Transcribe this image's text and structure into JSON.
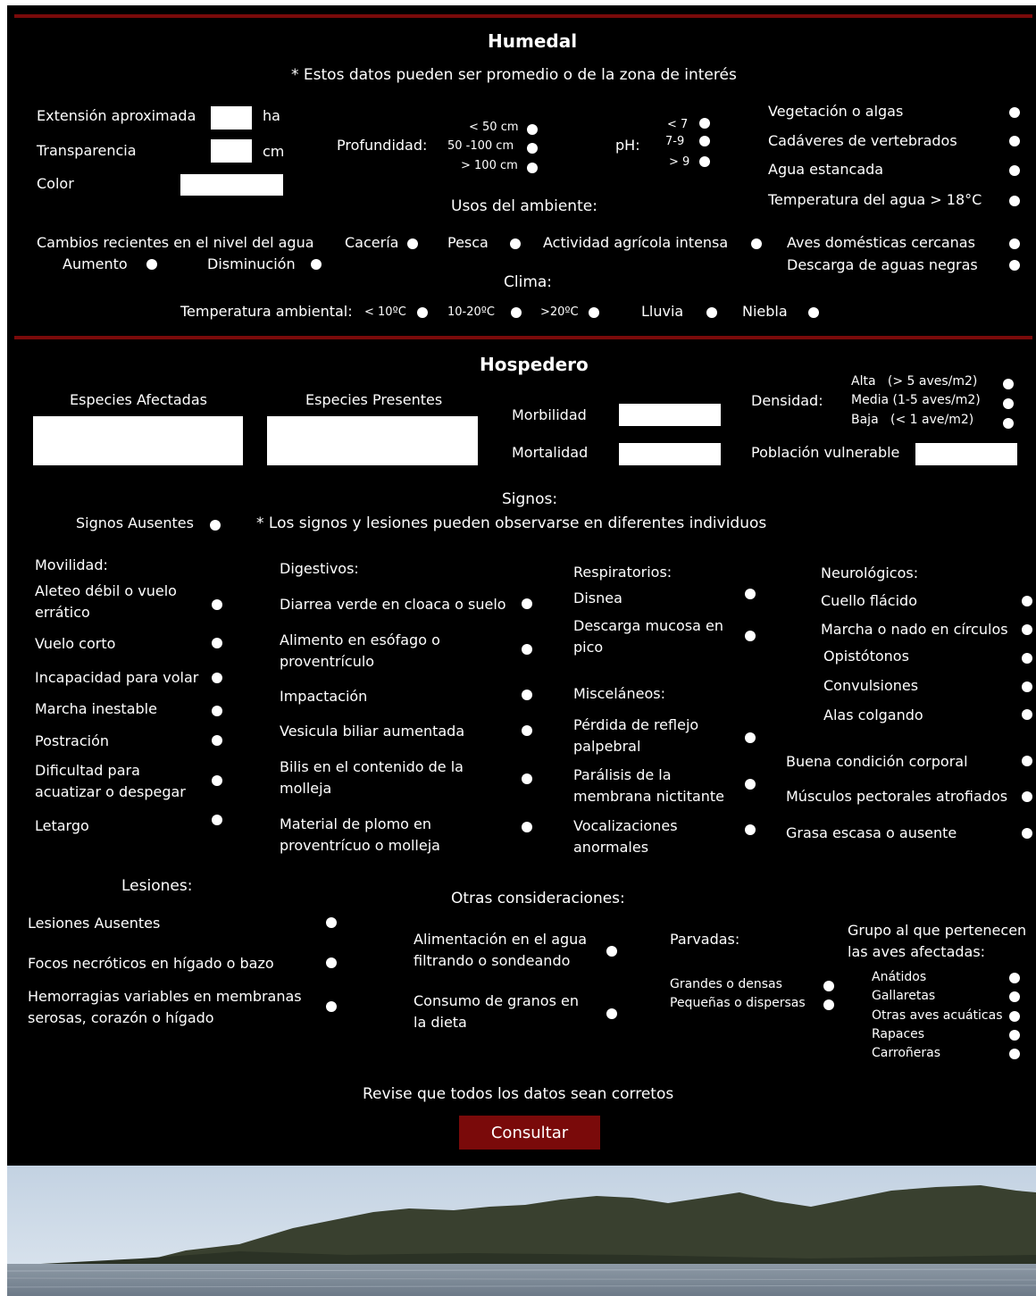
{
  "humedal": {
    "title": "Humedal",
    "note": "* Estos datos pueden ser promedio o de la zona de interés",
    "extension_label": "Extensión aproximada",
    "extension_unit": "ha",
    "transparencia_label": "Transparencia",
    "transparencia_unit": "cm",
    "color_label": "Color",
    "profundidad_label": "Profundidad:",
    "profundidad_options": [
      "< 50 cm",
      "50 -100 cm",
      "> 100 cm"
    ],
    "ph_label": "pH:",
    "ph_options": [
      "< 7",
      "7-9",
      "> 9"
    ],
    "right_options": [
      "Vegetación o algas",
      "Cadáveres de vertebrados",
      "Agua estancada",
      "Temperatura del agua  > 18°C"
    ],
    "usos_title": "Usos del ambiente:",
    "cambios_label": "Cambios recientes en el nivel del agua",
    "aumento_label": "Aumento",
    "disminucion_label": "Disminución",
    "caceria_label": "Cacería",
    "pesca_label": "Pesca",
    "agricola_label": "Actividad agrícola intensa",
    "aves_domesticas_label": "Aves domésticas cercanas",
    "descarga_label": "Descarga de aguas negras",
    "clima_title": "Clima:",
    "temp_label": "Temperatura ambiental:",
    "temp_options": [
      "< 10ºC",
      "10-20ºC",
      ">20ºC"
    ],
    "lluvia_label": "Lluvia",
    "niebla_label": "Niebla"
  },
  "hospedero": {
    "title": "Hospedero",
    "especies_afectadas_label": "Especies Afectadas",
    "especies_presentes_label": "Especies Presentes",
    "morbilidad_label": "Morbilidad",
    "mortalidad_label": "Mortalidad",
    "densidad_label": "Densidad:",
    "densidad_options": [
      "Alta   (> 5 aves/m2)",
      "Media (1-5 aves/m2)",
      "Baja   (< 1 ave/m2)"
    ],
    "poblacion_label": "Población vulnerable"
  },
  "signos": {
    "title": "Signos:",
    "ausentes_label": "Signos Ausentes",
    "note": "* Los signos y lesiones pueden observarse en diferentes individuos",
    "movilidad_title": "Movilidad:",
    "movilidad": [
      "Aleteo débil o vuelo errático",
      "Vuelo corto",
      "Incapacidad para volar",
      "Marcha inestable",
      "Postración",
      "Dificultad para acuatizar o despegar",
      "Letargo"
    ],
    "digestivos_title": "Digestivos:",
    "digestivos": [
      "Diarrea verde en cloaca o suelo",
      "Alimento en esófago o proventrículo",
      "Impactación",
      "Vesicula biliar aumentada",
      "Bilis en el contenido de la molleja",
      "Material de plomo en proventrícuo o molleja"
    ],
    "respiratorios_title": "Respiratorios:",
    "respiratorios": [
      "Disnea",
      "Descarga mucosa en pico"
    ],
    "miscelaneos_title": "Misceláneos:",
    "miscelaneos": [
      "Pérdida de reflejo palpebral",
      "Parálisis de la membrana nictitante",
      "Vocalizaciones anormales"
    ],
    "neurologicos_title": "Neurológicos:",
    "neurologicos": [
      "Cuello flácido",
      "Marcha o nado en círculos",
      "Opistótonos",
      "Convulsiones",
      "Alas colgando"
    ],
    "condicion": [
      "Buena condición corporal",
      "Músculos pectorales atrofiados",
      "Grasa escasa o ausente"
    ]
  },
  "lesiones": {
    "title": "Lesiones:",
    "items": [
      "Lesiones Ausentes",
      "Focos necróticos en hígado o bazo",
      "Hemorragias variables en membranas serosas, corazón o hígado"
    ]
  },
  "otras": {
    "title": "Otras consideraciones:",
    "alimentacion": [
      "Alimentación en el agua filtrando o sondeando",
      "Consumo de granos en la dieta"
    ],
    "parvadas_title": "Parvadas:",
    "parvadas": [
      "Grandes o densas",
      "Pequeñas o dispersas"
    ],
    "grupo_title": "Grupo al que pertenecen las aves afectadas:",
    "grupo": [
      "Anátidos",
      "Gallaretas",
      "Otras aves acuáticas",
      "Rapaces",
      "Carroñeras"
    ]
  },
  "footer": {
    "review_text": "Revise que todos los datos sean corretos",
    "submit_label": "Consultar"
  },
  "colors": {
    "background": "#000000",
    "accent": "#7a0a0a",
    "text": "#ffffff"
  }
}
